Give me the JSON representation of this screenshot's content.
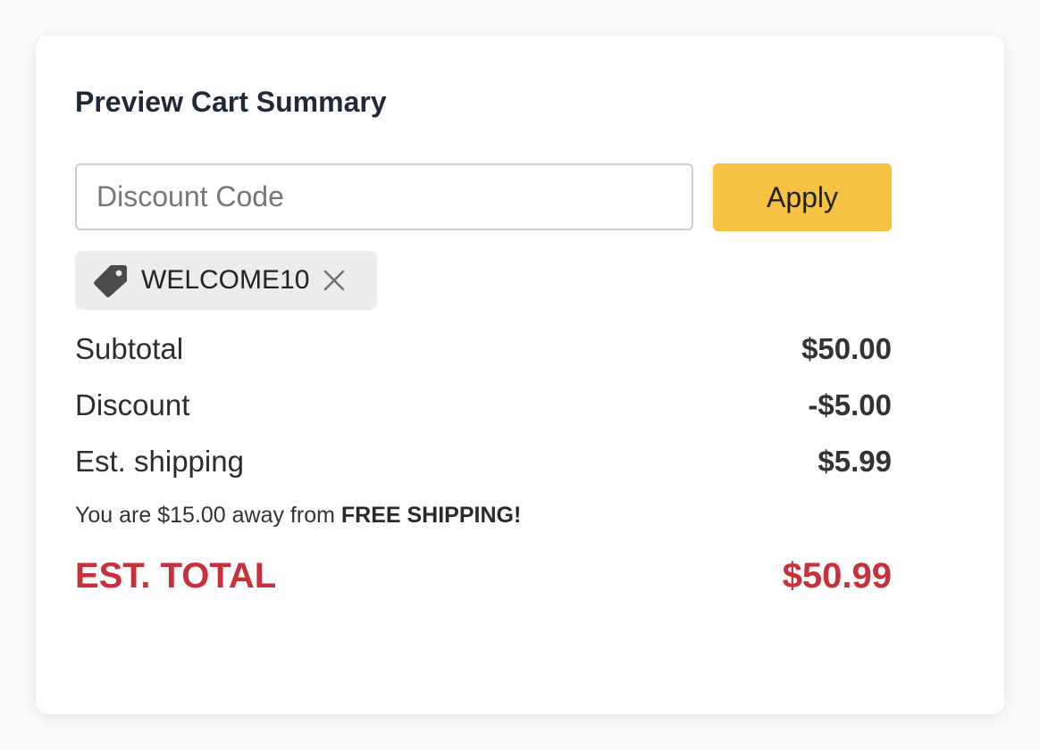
{
  "cart": {
    "title": "Preview Cart Summary",
    "discount_input": {
      "placeholder": "Discount Code",
      "value": ""
    },
    "apply_label": "Apply",
    "applied_code": {
      "code": "WELCOME10",
      "icon": "tag-icon",
      "remove_icon": "close-icon"
    },
    "lines": {
      "subtotal": {
        "label": "Subtotal",
        "value": "$50.00"
      },
      "discount": {
        "label": "Discount",
        "value": "-$5.00"
      },
      "shipping": {
        "label": "Est. shipping",
        "value": "$5.99"
      }
    },
    "promo": {
      "prefix": "You are $15.00 away from ",
      "highlight": "FREE SHIPPING!"
    },
    "total": {
      "label": "EST. TOTAL",
      "value": "$50.99"
    }
  },
  "colors": {
    "accent_button": "#f5c242",
    "total_red": "#c9303a",
    "chip_bg": "#ececec"
  }
}
